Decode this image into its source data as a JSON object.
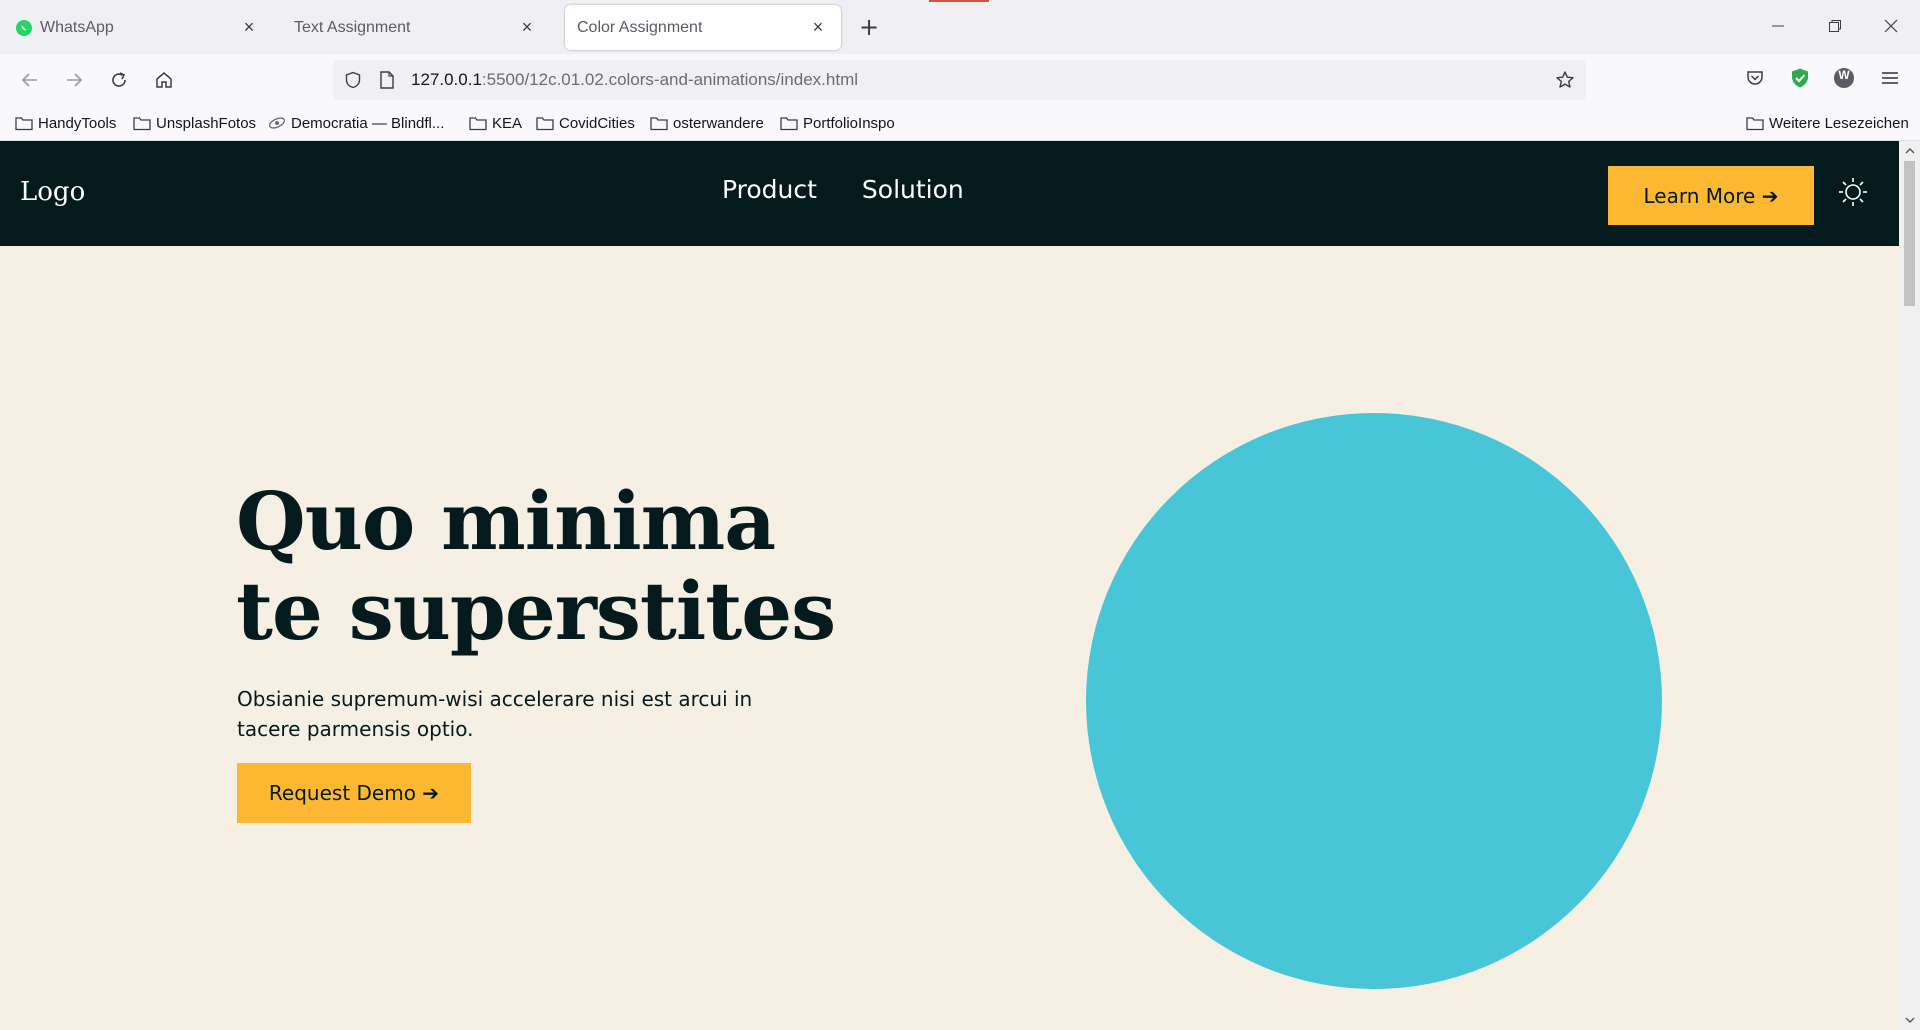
{
  "browser": {
    "tabs": [
      {
        "label": "WhatsApp",
        "active": false
      },
      {
        "label": "Text Assignment",
        "active": false
      },
      {
        "label": "Color Assignment",
        "active": true
      }
    ],
    "url_host": "127.0.0.1",
    "url_rest": ":5500/12c.01.02.colors-and-animations/index.html",
    "bookmarks": [
      {
        "label": "HandyTools",
        "icon": "folder-icon"
      },
      {
        "label": "UnsplashFotos",
        "icon": "folder-icon"
      },
      {
        "label": "Democratia — Blindfl...",
        "icon": "site-icon"
      },
      {
        "label": "KEA",
        "icon": "folder-icon"
      },
      {
        "label": "CovidCities",
        "icon": "folder-icon"
      },
      {
        "label": "osterwandere",
        "icon": "folder-icon"
      },
      {
        "label": "PortfolioInspo",
        "icon": "folder-icon"
      }
    ],
    "other_bookmarks": "Weitere Lesezeichen",
    "extension_letter": "W"
  },
  "site": {
    "logo": "Logo",
    "nav": [
      "Product",
      "Solution"
    ],
    "learn_more": "Learn More ➔",
    "hero": {
      "title_line1": "Quo minima",
      "title_line2": "te superstites",
      "text": "Obsianie supremum-wisi accelerare nisi est arcui in tacere parmensis optio.",
      "cta": "Request Demo ➔"
    }
  },
  "colors": {
    "header_bg": "#041a1d",
    "page_bg": "#f6f0e4",
    "accent": "#fdb833",
    "circle": "#48c6d8"
  }
}
